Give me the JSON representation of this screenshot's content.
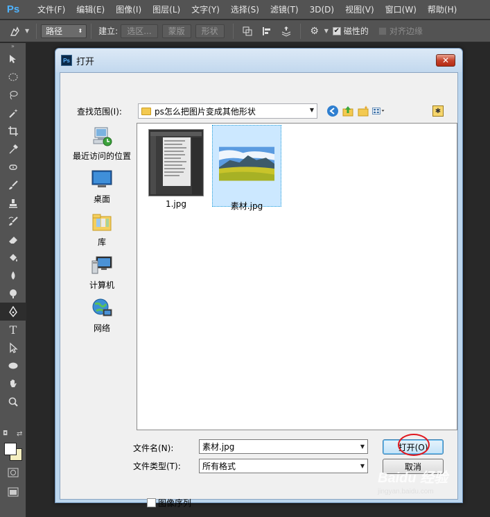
{
  "app": {
    "logo": "Ps",
    "menu": [
      "文件(F)",
      "编辑(E)",
      "图像(I)",
      "图层(L)",
      "文字(Y)",
      "选择(S)",
      "滤镜(T)",
      "3D(D)",
      "视图(V)",
      "窗口(W)",
      "帮助(H)"
    ]
  },
  "options": {
    "mode": "路径",
    "make_label": "建立:",
    "selection_btn": "选区...",
    "mask_btn": "蒙版",
    "shape_btn": "形状",
    "magnetic_label": "磁性的",
    "magnetic_checked": true,
    "align_edges_label": "对齐边缘",
    "align_edges_checked": false
  },
  "dialog": {
    "title": "打开",
    "look_in_label": "查找范围(I):",
    "look_in_value": "ps怎么把图片变成其他形状",
    "places": [
      {
        "label": "最近访问的位置",
        "icon": "recent-places-icon"
      },
      {
        "label": "桌面",
        "icon": "desktop-icon"
      },
      {
        "label": "库",
        "icon": "libraries-icon"
      },
      {
        "label": "计算机",
        "icon": "computer-icon"
      },
      {
        "label": "网络",
        "icon": "network-icon"
      }
    ],
    "files": [
      {
        "name": "1.jpg",
        "selected": false
      },
      {
        "name": "素材.jpg",
        "selected": true
      }
    ],
    "filename_label": "文件名(N):",
    "filename_value": "素材.jpg",
    "filetype_label": "文件类型(T):",
    "filetype_value": "所有格式",
    "open_btn": "打开(O)",
    "cancel_btn": "取消",
    "image_sequence_label": "图像序列"
  },
  "watermark": {
    "logo": "Baidu 经验",
    "url": "jingyan.baidu.com"
  }
}
